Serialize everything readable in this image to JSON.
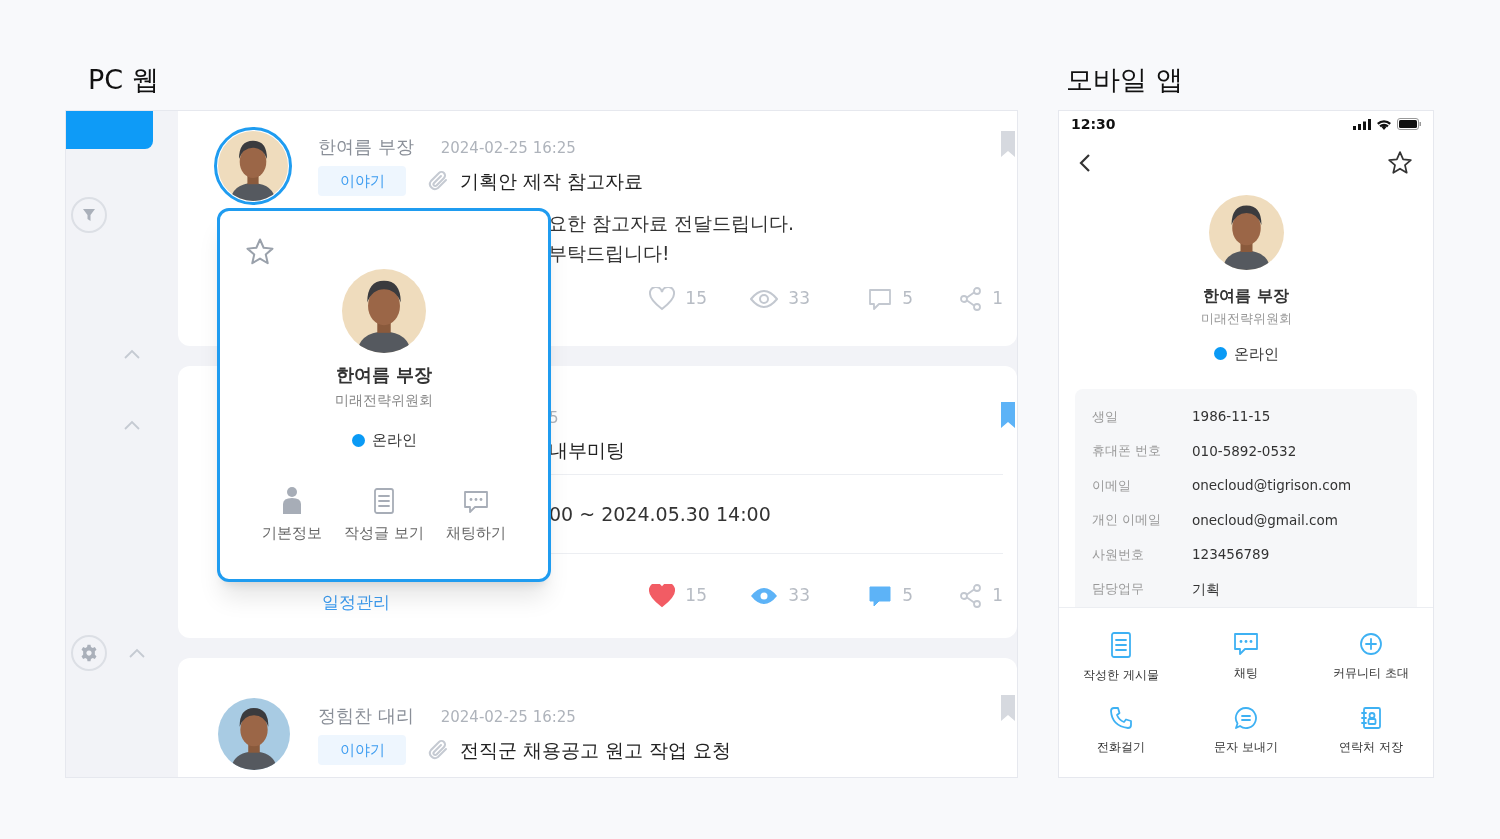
{
  "pc": {
    "heading": "PC 웹",
    "posts": [
      {
        "author": "한여름 부장",
        "date": "2024-02-25 16:25",
        "color": "#efdcbd",
        "highlighted": true,
        "tag": "이야기",
        "attachment": true,
        "title": "기획안 제작 참고자료",
        "body": [
          "요한 참고자료 전달드립니다.",
          "부탁드립니다!"
        ],
        "bookmarked": false,
        "stats": [
          {
            "kind": "like",
            "count": "15",
            "active": false
          },
          {
            "kind": "view",
            "count": "33",
            "active": false
          },
          {
            "kind": "comment",
            "count": "5",
            "active": false
          },
          {
            "kind": "share",
            "count": "1",
            "active": false
          }
        ]
      },
      {
        "date": "5",
        "title": "내부미팅",
        "schedule": "00 ~ 2024.05.30 14:00",
        "tag": "일정관리",
        "bookmarked": true,
        "stats": [
          {
            "kind": "like",
            "count": "15",
            "active": true
          },
          {
            "kind": "view",
            "count": "33",
            "active": true
          },
          {
            "kind": "comment",
            "count": "5",
            "active": true
          },
          {
            "kind": "share",
            "count": "1",
            "active": false
          }
        ]
      },
      {
        "author": "정힘찬 대리",
        "date": "2024-02-25 16:25",
        "color": "#a8cbe3",
        "highlighted": false,
        "tag": "이야기",
        "attachment": true,
        "title": "전직군 채용공고 원고 작업 요청",
        "bookmarked": false
      }
    ],
    "popup": {
      "starred": false,
      "name": "한여름 부장",
      "department": "미래전략위원회",
      "status": {
        "label": "온라인",
        "color": "#0a9af5"
      },
      "actions": [
        {
          "kind": "profile",
          "label": "기본정보"
        },
        {
          "kind": "posts",
          "label": "작성글 보기"
        },
        {
          "kind": "chat",
          "label": "채팅하기"
        }
      ]
    }
  },
  "mobile": {
    "heading": "모바일 앱",
    "time": "12:30",
    "starred": false,
    "name": "한여름 부장",
    "department": "미래전략위원회",
    "status": {
      "label": "온라인",
      "color": "#0a9af5"
    },
    "info": [
      {
        "label": "생일",
        "value": "1986-11-15"
      },
      {
        "label": "휴대폰 번호",
        "value": "010-5892-0532"
      },
      {
        "label": "이메일",
        "value": "onecloud@tigrison.com"
      },
      {
        "label": "개인 이메일",
        "value": "onecloud@gmail.com"
      },
      {
        "label": "사원번호",
        "value": "123456789"
      },
      {
        "label": "담당업무",
        "value": "기획"
      }
    ],
    "actions": [
      {
        "kind": "posts",
        "label": "작성한 게시물"
      },
      {
        "kind": "chat",
        "label": "채팅"
      },
      {
        "kind": "invite",
        "label": "커뮤니티 초대"
      },
      {
        "kind": "call",
        "label": "전화걸기"
      },
      {
        "kind": "message",
        "label": "문자 보내기"
      },
      {
        "kind": "contact",
        "label": "연락처 저장"
      }
    ]
  }
}
